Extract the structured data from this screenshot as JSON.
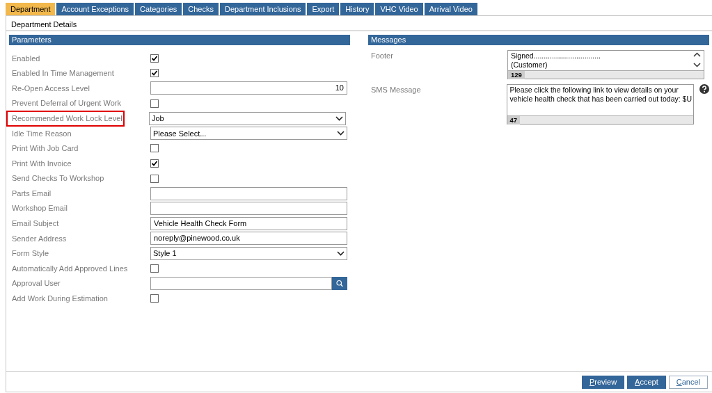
{
  "tabs": [
    {
      "label": "Department",
      "selected": true
    },
    {
      "label": "Account Exceptions",
      "selected": false
    },
    {
      "label": "Categories",
      "selected": false
    },
    {
      "label": "Checks",
      "selected": false
    },
    {
      "label": "Department Inclusions",
      "selected": false
    },
    {
      "label": "Export",
      "selected": false
    },
    {
      "label": "History",
      "selected": false
    },
    {
      "label": "VHC Video",
      "selected": false
    },
    {
      "label": "Arrival Video",
      "selected": false
    }
  ],
  "page_title": "Department Details",
  "parameters": {
    "title": "Parameters",
    "fields": [
      {
        "label": "Enabled",
        "kind": "checkbox",
        "checked": true,
        "highlighted": false
      },
      {
        "label": "Enabled In Time Management",
        "kind": "checkbox",
        "checked": true,
        "highlighted": false
      },
      {
        "label": "Re-Open Access Level",
        "kind": "number",
        "value": "10",
        "highlighted": false
      },
      {
        "label": "Prevent Deferral of Urgent Work",
        "kind": "checkbox",
        "checked": false,
        "highlighted": false
      },
      {
        "label": "Recommended Work Lock Level",
        "kind": "select",
        "value": "Job",
        "highlighted": true
      },
      {
        "label": "Idle Time Reason",
        "kind": "select",
        "value": "Please Select...",
        "highlighted": false
      },
      {
        "label": "Print With Job Card",
        "kind": "checkbox",
        "checked": false,
        "highlighted": false
      },
      {
        "label": "Print With Invoice",
        "kind": "checkbox",
        "checked": true,
        "highlighted": false
      },
      {
        "label": "Send Checks To Workshop",
        "kind": "checkbox",
        "checked": false,
        "highlighted": false
      },
      {
        "label": "Parts Email",
        "kind": "text",
        "highlighted": false
      },
      {
        "label": "Workshop Email",
        "kind": "text",
        "highlighted": false
      },
      {
        "label": "Email Subject",
        "kind": "text",
        "value": "Vehicle Health Check Form",
        "highlighted": false
      },
      {
        "label": "Sender Address",
        "kind": "text",
        "value": "noreply@pinewood.co.uk",
        "highlighted": false
      },
      {
        "label": "Form Style",
        "kind": "select",
        "value": "Style 1",
        "highlighted": false
      },
      {
        "label": "Automatically Add Approved Lines",
        "kind": "checkbox",
        "checked": false,
        "highlighted": false
      },
      {
        "label": "Approval User",
        "kind": "lookup",
        "highlighted": false
      },
      {
        "label": "Add Work During Estimation",
        "kind": "checkbox",
        "checked": false,
        "highlighted": false
      }
    ]
  },
  "messages": {
    "title": "Messages",
    "fields": [
      {
        "label": "Footer",
        "lines": [
          "Signed.................................",
          "(Customer)"
        ],
        "count": "129",
        "scrollbar": true,
        "help": false
      },
      {
        "label": "SMS Message",
        "lines": [
          "Please click the following link to view details on your",
          "vehicle health check that has been carried out today: $U"
        ],
        "count": "47",
        "scrollbar": false,
        "help": true
      }
    ]
  },
  "buttons": [
    {
      "label": "Preview",
      "kind": "primary",
      "underline_first": true
    },
    {
      "label": "Accept",
      "kind": "primary",
      "underline_first": true
    },
    {
      "label": "Cancel",
      "kind": "secondary",
      "underline_first": true
    }
  ]
}
